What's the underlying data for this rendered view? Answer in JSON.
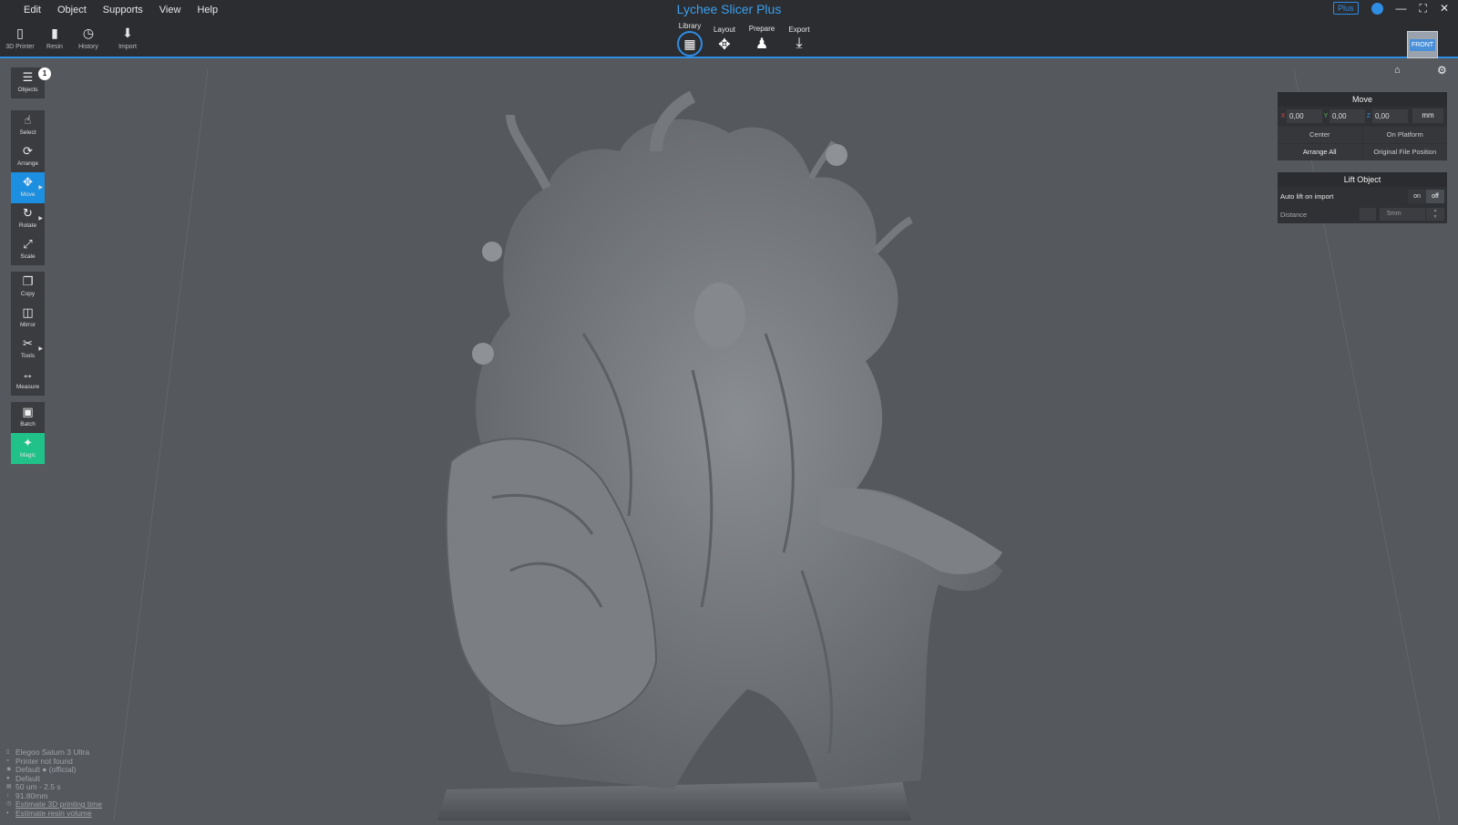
{
  "menu": [
    "Edit",
    "Object",
    "Supports",
    "View",
    "Help"
  ],
  "app_title": "Lychee Slicer Plus",
  "plus_badge": "Plus",
  "toolbar": {
    "printer": "3D Printer",
    "resin": "Resin",
    "history": "History",
    "import": "Import"
  },
  "stages": [
    "Library",
    "Layout",
    "Prepare",
    "Export"
  ],
  "view_cube": "FRONT",
  "sidebar": {
    "objects_count": "1",
    "items": [
      "Objects",
      "Select",
      "Arrange",
      "Move",
      "Rotate",
      "Scale",
      "Copy",
      "Mirror",
      "Tools",
      "Measure",
      "Batch",
      "Magic"
    ]
  },
  "move_panel": {
    "title": "Move",
    "x_label": "X",
    "y_label": "Y",
    "z_label": "Z",
    "x": "0,00",
    "y": "0,00",
    "z": "0,00",
    "unit": "mm",
    "center": "Center",
    "on_platform": "On Platform",
    "arrange_all": "Arrange All",
    "original_position": "Original File Position"
  },
  "lift_panel": {
    "title": "Lift Object",
    "auto_lift": "Auto lift on import",
    "on": "on",
    "off": "off",
    "distance": "Distance",
    "distance_value": "5",
    "distance_unit": "mm"
  },
  "info": {
    "printer": "Elegoo Saturn 3 Ultra",
    "status": "Printer not found",
    "profile": "Default ● (official)",
    "resin": "Default",
    "layer": "50 um - 2.5 s",
    "height": "91.80mm",
    "estimate_time": "Estimate 3D printing time",
    "estimate_volume": "Estimate resin volume"
  },
  "colors": {
    "accent": "#2f8de4",
    "magic": "#21c28a",
    "background": "#55585d",
    "bar": "#2b2d30"
  }
}
